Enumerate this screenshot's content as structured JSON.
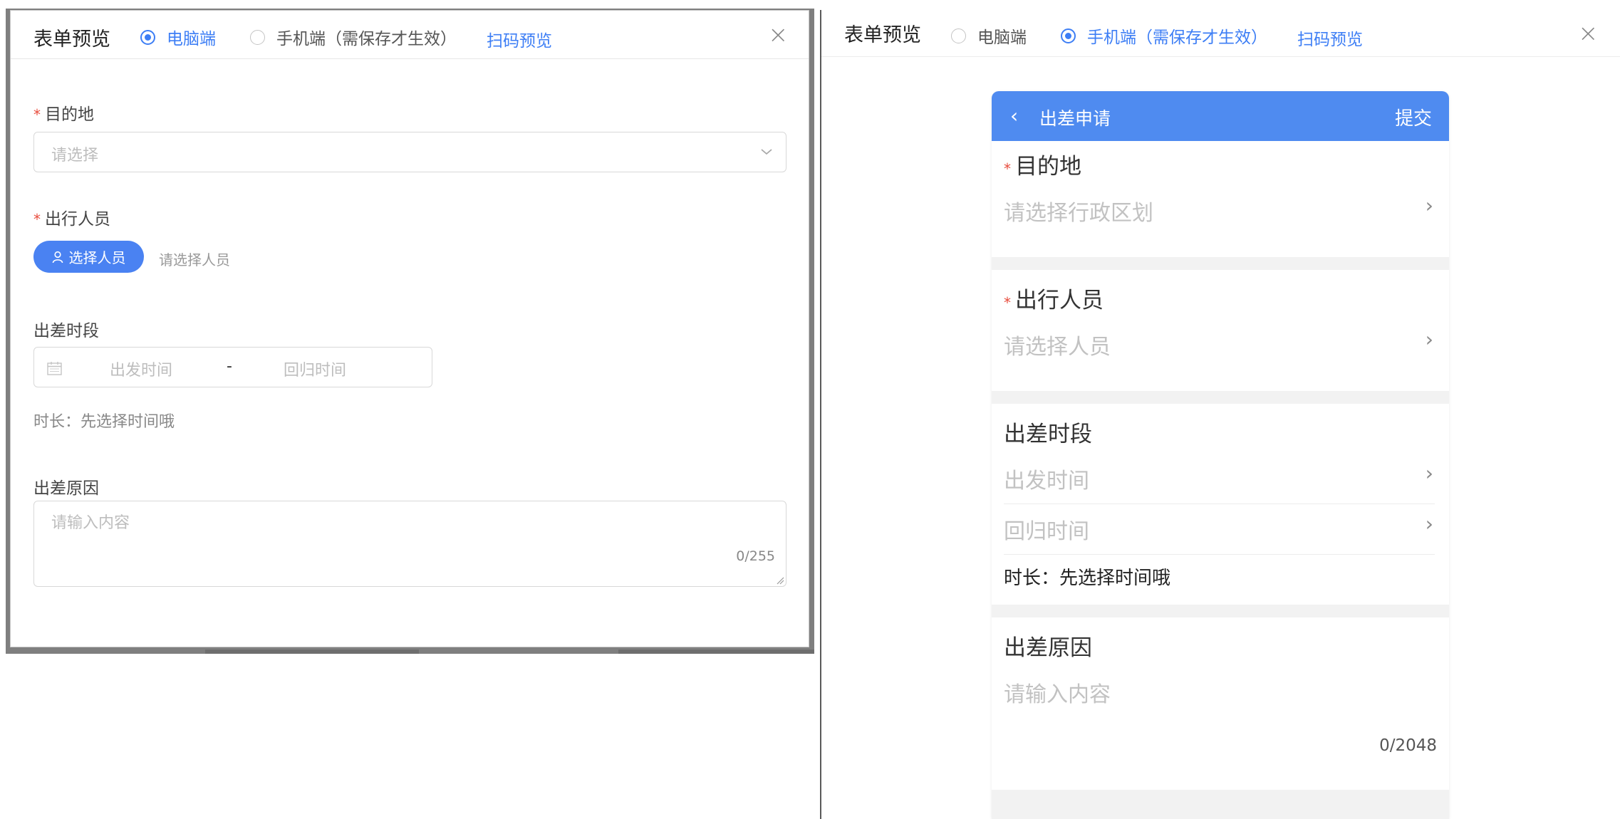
{
  "left": {
    "title": "表单预览",
    "radio_pc": "电脑端",
    "radio_mobile": "手机端（需保存才生效）",
    "scan_preview": "扫码预览",
    "close": "×",
    "destination": {
      "label": "目的地",
      "required": "*",
      "placeholder": "请选择"
    },
    "travelers": {
      "label": "出行人员",
      "required": "*",
      "button": "选择人员",
      "hint": "请选择人员"
    },
    "period": {
      "label": "出差时段",
      "start": "出发时间",
      "sep": "-",
      "end": "回归时间"
    },
    "duration": "时长：先选择时间哦",
    "reason": {
      "label": "出差原因",
      "placeholder": "请输入内容",
      "counter": "0/255"
    }
  },
  "right": {
    "title": "表单预览",
    "radio_pc": "电脑端",
    "radio_mobile": "手机端（需保存才生效）",
    "scan_preview": "扫码预览",
    "close": "×",
    "phone": {
      "back": "‹",
      "title": "出差申请",
      "submit": "提交",
      "destination": {
        "label": "目的地",
        "required": "*",
        "placeholder": "请选择行政区划"
      },
      "travelers": {
        "label": "出行人员",
        "required": "*",
        "placeholder": "请选择人员"
      },
      "period": {
        "label": "出差时段",
        "start": "出发时间",
        "end": "回归时间"
      },
      "duration": "时长：先选择时间哦",
      "reason": {
        "label": "出差原因",
        "placeholder": "请输入内容",
        "counter": "0/2048"
      },
      "chevron": "›"
    }
  },
  "colors": {
    "accent": "#3d7ef5",
    "phone_bar": "#4f8bf0",
    "required": "#e84c3d"
  },
  "icons": [
    "radio-icon",
    "close-icon",
    "chevron-down-icon",
    "user-icon",
    "calendar-icon",
    "resize-icon",
    "back-icon",
    "chevron-right-icon"
  ]
}
